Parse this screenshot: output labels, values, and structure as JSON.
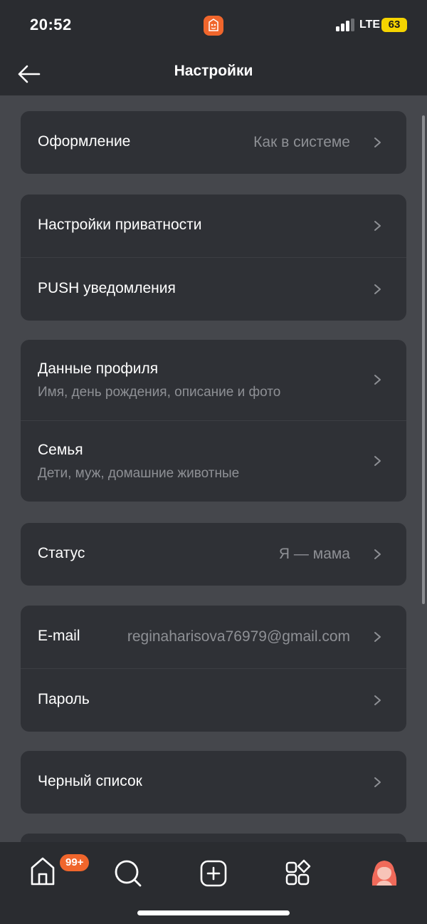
{
  "status_bar": {
    "time": "20:52",
    "network": "LTE",
    "battery": "63"
  },
  "header": {
    "title": "Настройки",
    "back_icon": "arrow-left-icon"
  },
  "groups": [
    {
      "items": [
        {
          "title": "Оформление",
          "value": "Как в системе"
        }
      ]
    },
    {
      "items": [
        {
          "title": "Настройки приватности"
        },
        {
          "title": "PUSH уведомления"
        }
      ]
    },
    {
      "items": [
        {
          "title": "Данные профиля",
          "subtitle": "Имя, день рождения, описание и фото"
        },
        {
          "title": "Семья",
          "subtitle": "Дети, муж, домашние животные"
        }
      ]
    },
    {
      "items": [
        {
          "title": "Статус",
          "value": "Я — мама"
        }
      ]
    },
    {
      "items": [
        {
          "title": "E-mail",
          "value": "reginaharisova76979@gmail.com"
        },
        {
          "title": "Пароль"
        }
      ]
    },
    {
      "items": [
        {
          "title": "Черный список"
        }
      ]
    }
  ],
  "tab_bar": {
    "home_badge": "99+",
    "tabs": [
      "home-icon",
      "search-icon",
      "add-icon",
      "apps-icon",
      "profile-avatar-icon"
    ]
  },
  "colors": {
    "accent": "#f0662c",
    "background": "#45474c",
    "card": "#2f3136",
    "bar": "#2a2c30",
    "secondary_text": "#8e9095",
    "battery": "#f5d400"
  }
}
